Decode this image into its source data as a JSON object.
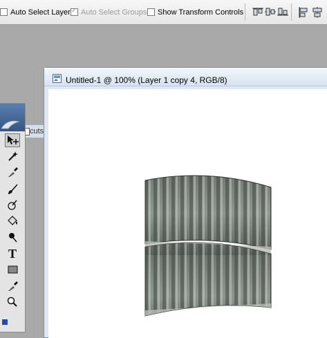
{
  "options_bar": {
    "auto_select_layer": {
      "label": "Auto Select Layer",
      "checked": false
    },
    "auto_select_groups": {
      "label": "Auto Select Groups",
      "checked": true,
      "disabled": true
    },
    "show_transform_controls": {
      "label": "Show Transform Controls",
      "checked": false
    },
    "align_buttons": [
      "align-top-edges-icon",
      "align-vertical-centers-icon",
      "align-bottom-edges-icon",
      "align-left-edges-icon",
      "align-horizontal-centers-icon"
    ]
  },
  "document": {
    "title": "Untitled-1 @ 100% (Layer 1 copy 4, RGB/8)",
    "icon": "photoshop-document-icon"
  },
  "background_tab": {
    "label": "cuts"
  },
  "tools": [
    {
      "name": "move-tool",
      "icon": "move-icon",
      "active": true
    },
    {
      "name": "magic-wand-tool",
      "icon": "magic-wand-icon"
    },
    {
      "name": "eyedropper-tool",
      "icon": "eyedropper-icon"
    },
    {
      "name": "brush-tool",
      "icon": "brush-icon"
    },
    {
      "name": "history-brush-tool",
      "icon": "history-brush-icon"
    },
    {
      "name": "paint-bucket-tool",
      "icon": "paint-bucket-icon"
    },
    {
      "name": "burn-tool",
      "icon": "burn-icon"
    },
    {
      "name": "type-tool",
      "icon": "type-icon",
      "label": "T"
    },
    {
      "name": "rectangle-tool",
      "icon": "rectangle-icon"
    },
    {
      "name": "eyedropper-sampler-tool",
      "icon": "eyedropper-icon"
    },
    {
      "name": "zoom-tool",
      "icon": "zoom-icon"
    }
  ],
  "colors": {
    "accent": "#3b5b86",
    "canvas": "#ffffff",
    "workspace": "#a9a9a9",
    "foreground_swatch": "#1a4fb0"
  }
}
